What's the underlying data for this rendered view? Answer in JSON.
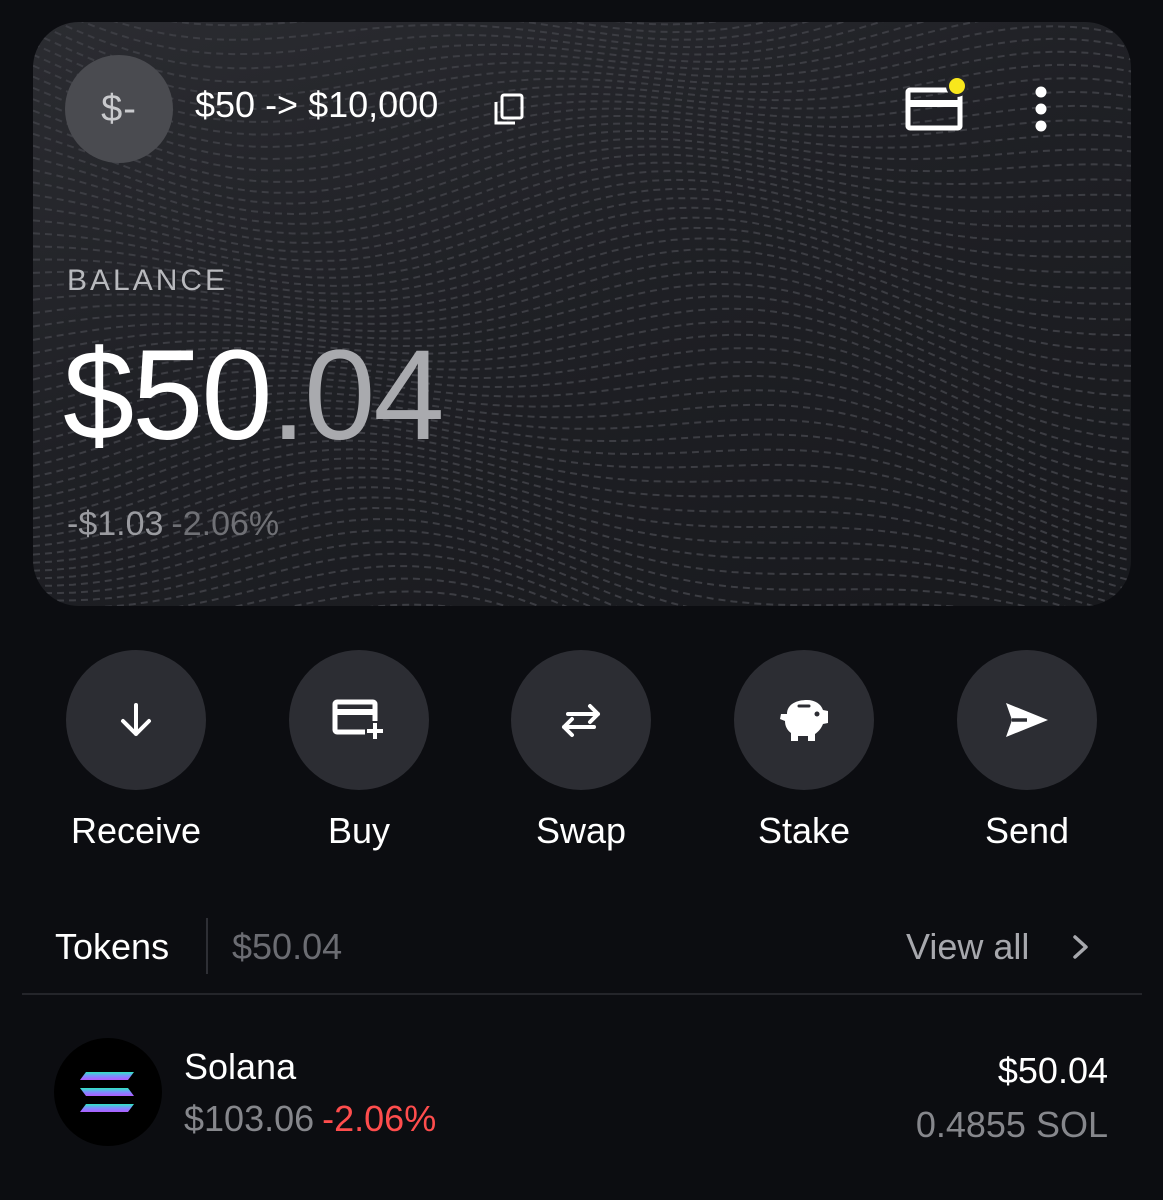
{
  "account": {
    "avatar_text": "$-",
    "name": "$50 -> $10,000"
  },
  "balance": {
    "label": "BALANCE",
    "amount_int": "$50",
    "amount_dec": ".04",
    "change_abs": "-$1.03",
    "change_pct": "-2.06%"
  },
  "actions": [
    {
      "label": "Receive",
      "icon": "arrow-down-icon"
    },
    {
      "label": "Buy",
      "icon": "card-plus-icon"
    },
    {
      "label": "Swap",
      "icon": "swap-arrows-icon"
    },
    {
      "label": "Stake",
      "icon": "piggy-bank-icon"
    },
    {
      "label": "Send",
      "icon": "send-icon"
    }
  ],
  "tokens": {
    "title": "Tokens",
    "total": "$50.04",
    "view_all": "View all",
    "items": [
      {
        "name": "Solana",
        "price": "$103.06",
        "change": "-2.06%",
        "value": "$50.04",
        "amount": "0.4855 SOL"
      }
    ]
  },
  "colors": {
    "background": "#0c0d11",
    "card": "#25262b",
    "button": "#2c2d33",
    "notification": "#f8e71c",
    "negative": "#ff4d4d",
    "muted": "#86878c"
  }
}
